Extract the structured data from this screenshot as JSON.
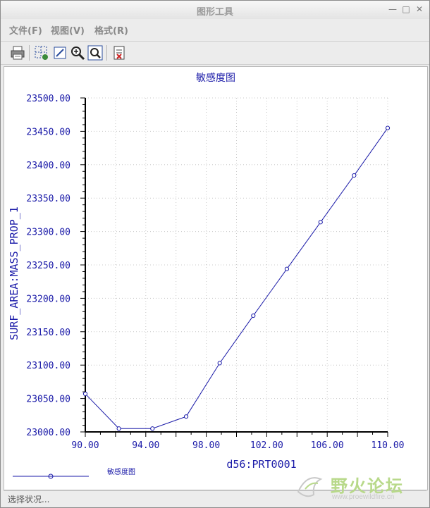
{
  "window": {
    "title": "图形工具",
    "controls": [
      "minimize",
      "maximize",
      "close"
    ]
  },
  "menu": {
    "file": "文件(F)",
    "view": "视图(V)",
    "format": "格式(R)"
  },
  "toolbar": {
    "icons": [
      "print-icon",
      "grid-icon",
      "edit-icon",
      "zoom-in-icon",
      "zoom-fit-icon",
      "export-icon"
    ]
  },
  "chart_data": {
    "type": "line",
    "title": "敏感度图",
    "xlabel": "d56:PRT0001",
    "ylabel": "SURF_AREA:MASS_PROP_1",
    "xlim": [
      90,
      110
    ],
    "ylim": [
      23000,
      23500
    ],
    "x_ticks": [
      "90.00",
      "94.00",
      "98.00",
      "102.00",
      "106.00",
      "110.00"
    ],
    "y_ticks": [
      "23500.00",
      "23450.00",
      "23400.00",
      "23350.00",
      "23300.00",
      "23250.00",
      "23200.00",
      "23150.00",
      "23100.00",
      "23050.00",
      "23000.00"
    ],
    "grid": true,
    "legend_position": "bottom-left",
    "series": [
      {
        "name": "敏感度图",
        "color": "#1a1aa8",
        "x": [
          90.0,
          92.22,
          94.44,
          96.67,
          98.89,
          101.11,
          103.33,
          105.56,
          107.78,
          110.0
        ],
        "y": [
          23057,
          23005,
          23005,
          23023,
          23103,
          23174,
          23244,
          23314,
          23384,
          23455
        ]
      }
    ]
  },
  "status": {
    "text": "选择状况..."
  },
  "watermark": {
    "main": "野火论坛",
    "url": "www.proewildfire.cn"
  }
}
